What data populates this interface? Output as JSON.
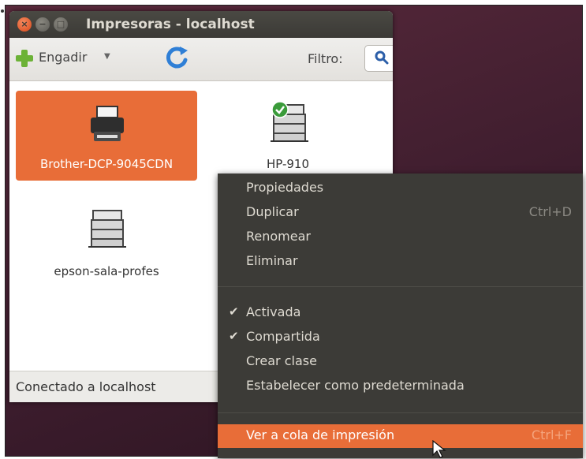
{
  "window": {
    "title": "Impresoras - localhost",
    "close_glyph": "×",
    "min_glyph": "−",
    "max_glyph": "□"
  },
  "toolbar": {
    "add_label": "Engadir",
    "add_arrow": "▼",
    "refresh_icon": "refresh-icon",
    "filter_label": "Filtro:",
    "search_value": ""
  },
  "printers": [
    {
      "name": "Brother-DCP-9045CDN",
      "selected": true,
      "icon": "printer-icon"
    },
    {
      "name": "HP-910",
      "selected": false,
      "icon": "printer-stack-default-icon",
      "default": true
    },
    {
      "name": "epson-sala-profes",
      "selected": false,
      "icon": "printer-stack-icon"
    }
  ],
  "status": {
    "text": "Conectado a localhost"
  },
  "context_menu": {
    "items": [
      {
        "label": "Propiedades",
        "accel": "",
        "checked": false
      },
      {
        "label": "Duplicar",
        "accel": "Ctrl+D",
        "checked": false
      },
      {
        "label": "Renomear",
        "accel": "",
        "checked": false
      },
      {
        "label": "Eliminar",
        "accel": "",
        "checked": false
      },
      {
        "label": "Activada",
        "accel": "",
        "checked": true
      },
      {
        "label": "Compartida",
        "accel": "",
        "checked": true
      },
      {
        "label": "Crear clase",
        "accel": "",
        "checked": false
      },
      {
        "label": "Estabelecer como predeterminada",
        "accel": "",
        "checked": false
      },
      {
        "label": "Ver a cola de impresión",
        "accel": "Ctrl+F",
        "checked": false,
        "highlighted": true
      }
    ],
    "check_glyph": "✔"
  },
  "colors": {
    "accent": "#e86d38",
    "menu_bg": "#3c3b37",
    "titlebar": "#3b3a36",
    "add_green": "#6cb237",
    "refresh_blue": "#2f7fd6",
    "default_badge": "#3a9b3a"
  }
}
